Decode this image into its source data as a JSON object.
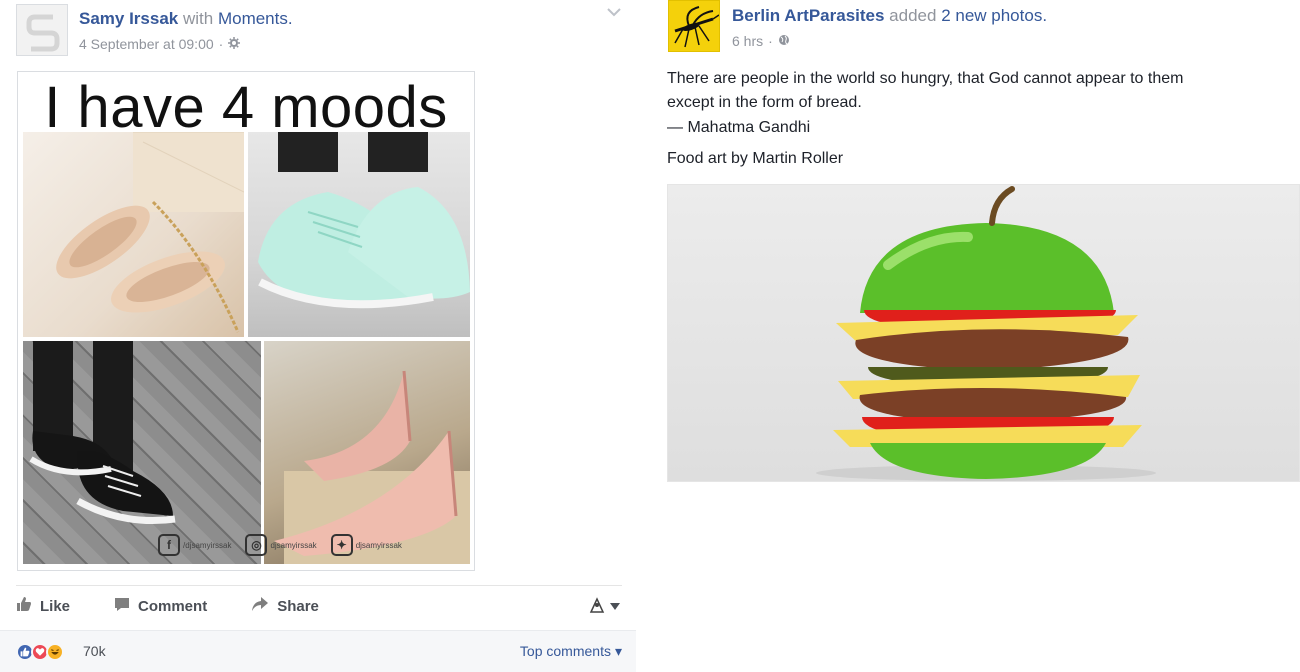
{
  "left_post": {
    "author": "Samy Irssak",
    "with_text": "with",
    "tagged": "Moments.",
    "timestamp": "4 September at 09:00",
    "separator": "·",
    "audience_icon": "gear-icon",
    "menu_icon": "chevron-down-icon",
    "photo_title": "I have 4 moods",
    "watermarks": [
      {
        "icon": "facebook-icon",
        "glyph": "f",
        "text": "/djsamyirssak"
      },
      {
        "icon": "instagram-icon",
        "glyph": "◎",
        "text": "djsamyirssak"
      },
      {
        "icon": "twitter-icon",
        "glyph": "✦",
        "text": "djsamyirssak"
      }
    ],
    "actions": {
      "like": "Like",
      "comment": "Comment",
      "share": "Share"
    },
    "reactions": [
      "like",
      "love",
      "haha"
    ],
    "reaction_count": "70k",
    "comments_order": "Top comments",
    "comments_order_caret": "▾"
  },
  "right_post": {
    "author": "Berlin ArtParasites",
    "action_text": "added",
    "action_object": "2 new photos.",
    "timestamp": "6 hrs",
    "separator": "·",
    "audience_icon": "globe-icon",
    "lines": [
      "There are people in the world so hungry, that God cannot appear to them",
      "except in the form of bread.",
      "— Mahatma Gandhi",
      "Food art by Martin Roller"
    ]
  },
  "colors": {
    "link": "#365899",
    "muted": "#90949c",
    "text": "#1d2129",
    "artparasites_yellow": "#f4d10b",
    "like_blue": "#4267b2",
    "love_red": "#ed4956",
    "haha_yellow": "#f7b125"
  }
}
